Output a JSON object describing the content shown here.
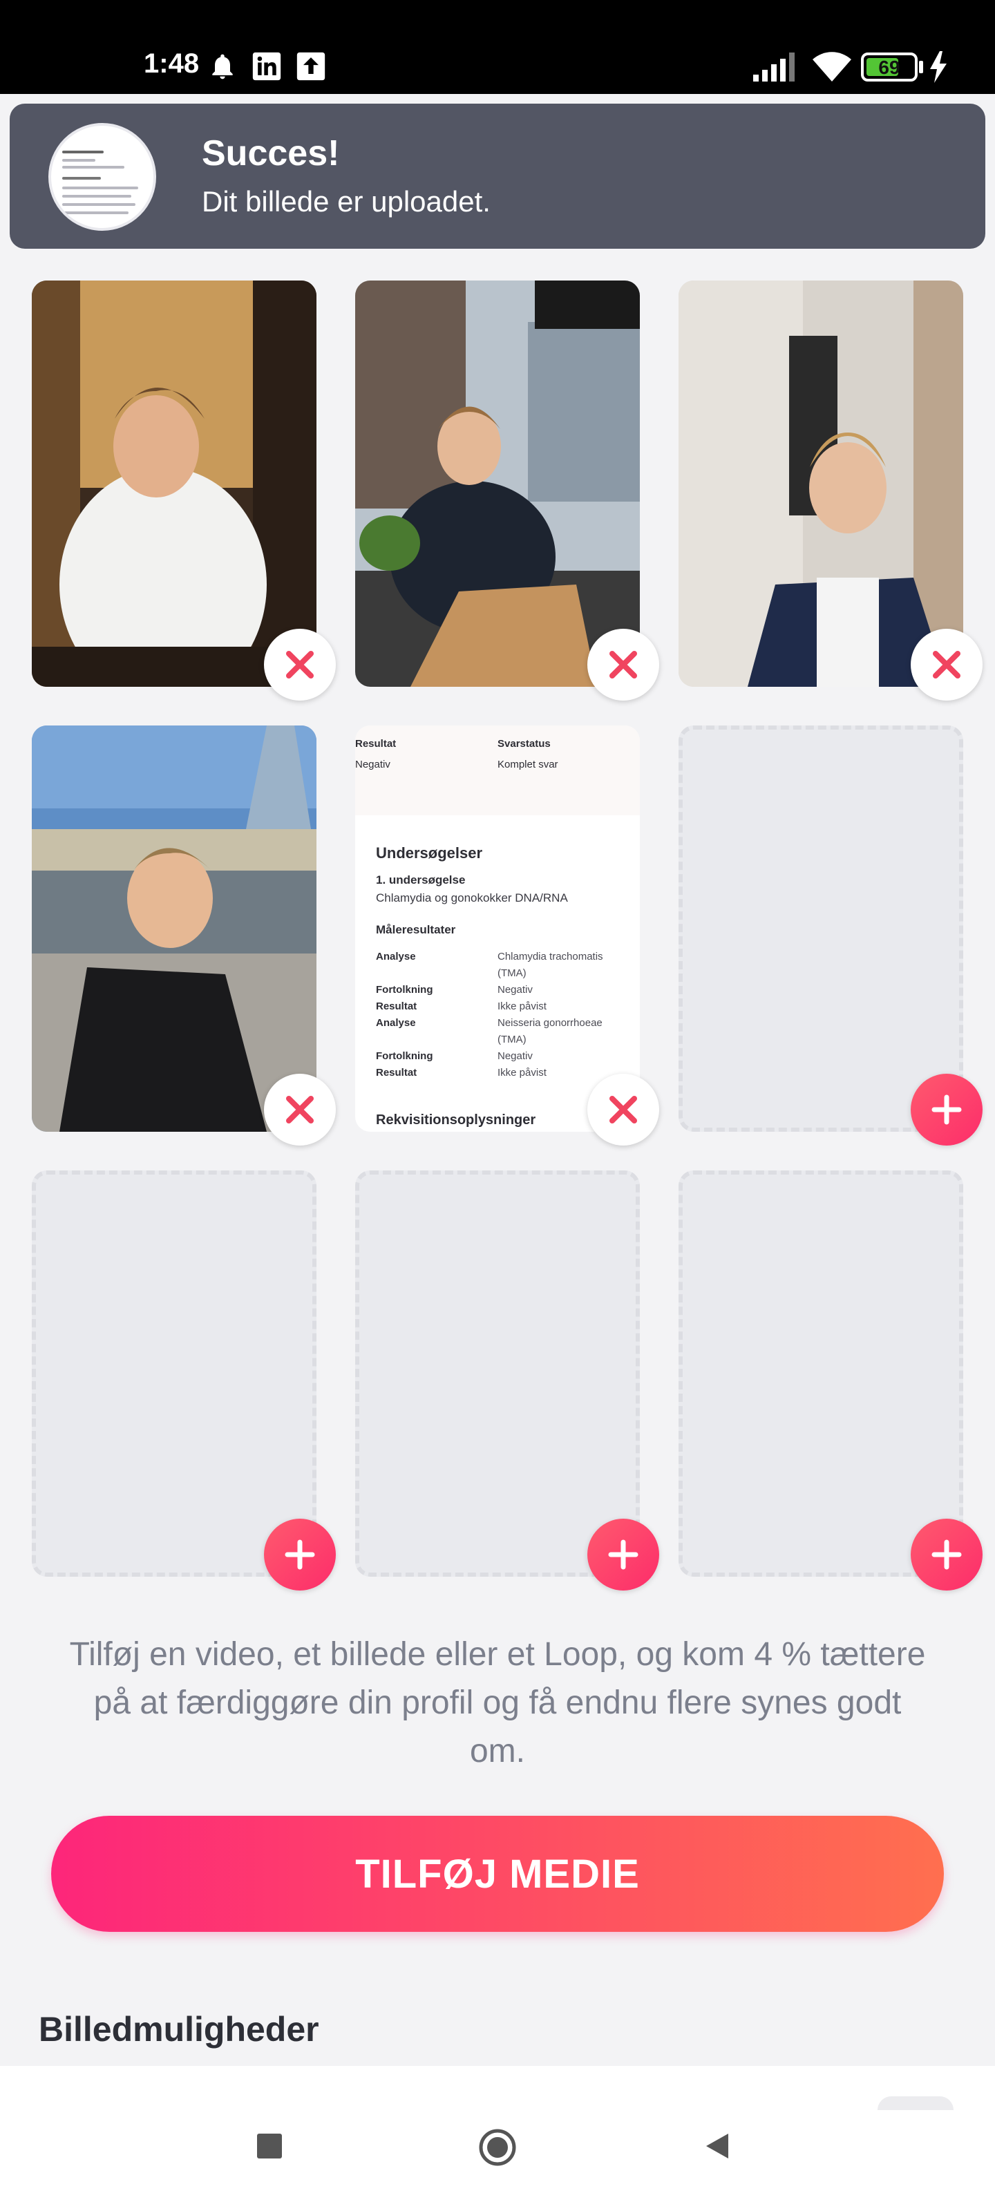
{
  "status_bar": {
    "time": "1:48",
    "battery": "69",
    "battery_level": 0.69,
    "icons": [
      "bell-icon",
      "linkedin-icon",
      "upload-icon",
      "signal-icon",
      "wifi-icon",
      "battery-icon",
      "charging-icon"
    ]
  },
  "toast": {
    "title": "Succes!",
    "message": "Dit billede er uploadet."
  },
  "document_preview": {
    "col1_header": "Resultat",
    "col1_value": "Negativ",
    "col2_header": "Svarstatus",
    "col2_value": "Komplet svar",
    "section_title": "Undersøgelser",
    "sub_title": "1. undersøgelse",
    "sub_value": "Chlamydia og gonokokker DNA/RNA",
    "results_title": "Måleresultater",
    "rows": [
      {
        "label": "Analyse",
        "value": "Chlamydia trachomatis"
      },
      {
        "label": "",
        "value": "(TMA)"
      },
      {
        "label": "Fortolkning",
        "value": "Negativ"
      },
      {
        "label": "Resultat",
        "value": "Ikke påvist"
      },
      {
        "label": "Analyse",
        "value": "Neisseria gonorrhoeae"
      },
      {
        "label": "",
        "value": "(TMA)"
      },
      {
        "label": "Fortolkning",
        "value": "Negativ"
      },
      {
        "label": "Resultat",
        "value": "Ikke påvist"
      }
    ],
    "footer_title": "Rekvisitionsoplysninger"
  },
  "info_text": "Tilføj en video, et billede eller et Loop, og kom 4 % tættere på at færdiggøre din profil og få endnu flere synes godt om.",
  "cta_label": "TILFØJ MEDIE",
  "section_title": "Billedmuligheder",
  "colors": {
    "accent": "#fd2d6a",
    "accent_gradient_end": "#ff6f4f",
    "toast_bg": "#535664",
    "page_bg": "#f3f3f5"
  }
}
